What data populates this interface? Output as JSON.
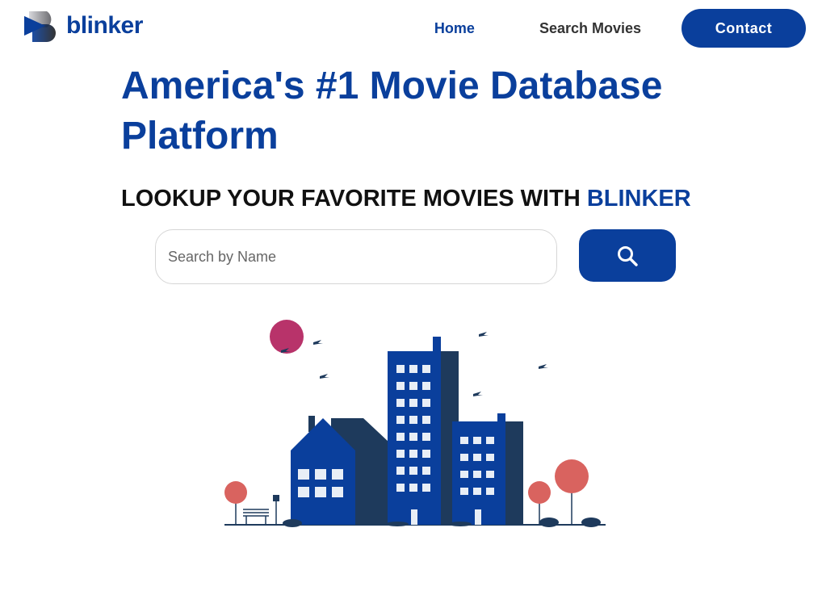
{
  "header": {
    "logo_text": "blinker",
    "nav": {
      "home": "Home",
      "search_movies": "Search Movies",
      "contact": "Contact"
    }
  },
  "hero": {
    "title": "America's #1 Movie Database Platform",
    "subtitle_prefix": "LOOKUP YOUR FAVORITE MOVIES WITH ",
    "subtitle_brand": "BLINKER"
  },
  "search": {
    "placeholder": "Search by Name",
    "value": "",
    "icon": "search-icon"
  },
  "colors": {
    "brand": "#0a3f9c",
    "building_dark": "#1e3a5c",
    "sun": "#b8336a",
    "tree": "#d9635f"
  }
}
